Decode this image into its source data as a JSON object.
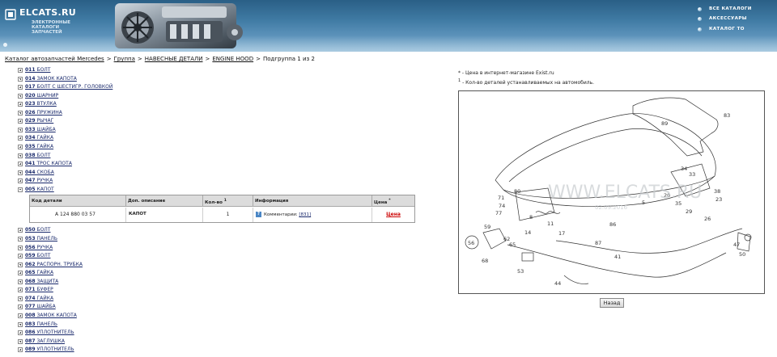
{
  "header": {
    "logo_title": "ELCATS.RU",
    "logo_subtitle": "ЭЛЕКТРОННЫЕ КАТАЛОГИ\nЗАПЧАСТЕЙ",
    "nav": [
      "ВСЕ КАТАЛОГИ",
      "АКСЕССУАРЫ",
      "КАТАЛОГ ТО"
    ]
  },
  "breadcrumb": {
    "items": [
      "Каталог автозапчастей Mercedes",
      "Группа",
      "НАВЕСНЫЕ ДЕТАЛИ",
      "ENGINE HOOD"
    ],
    "separator": ">",
    "current": "Подгруппа 1 из 2"
  },
  "groups": [
    {
      "code": "011",
      "name": "БОЛТ",
      "expanded": false
    },
    {
      "code": "014",
      "name": "ЗАМОК КАПОТА",
      "expanded": false
    },
    {
      "code": "017",
      "name": "БОЛТ С ШЕСТИГР. ГОЛОВКОЙ",
      "expanded": false
    },
    {
      "code": "020",
      "name": "ШАРНИР",
      "expanded": false
    },
    {
      "code": "023",
      "name": "ВТУЛКА",
      "expanded": false
    },
    {
      "code": "026",
      "name": "ПРУЖИНА",
      "expanded": false
    },
    {
      "code": "029",
      "name": "РЫЧАГ",
      "expanded": false
    },
    {
      "code": "033",
      "name": "ШАЙБА",
      "expanded": false
    },
    {
      "code": "034",
      "name": "ГАЙКА",
      "expanded": false
    },
    {
      "code": "035",
      "name": "ГАЙКА",
      "expanded": false
    },
    {
      "code": "038",
      "name": "БОЛТ",
      "expanded": false
    },
    {
      "code": "041",
      "name": "ТРОС КАПОТА",
      "expanded": false
    },
    {
      "code": "044",
      "name": "СКОБА",
      "expanded": false
    },
    {
      "code": "047",
      "name": "РУЧКА",
      "expanded": false
    },
    {
      "code": "005",
      "name": "КАПОТ",
      "expanded": true
    },
    {
      "code": "050",
      "name": "БОЛТ",
      "expanded": false
    },
    {
      "code": "053",
      "name": "ПАНЕЛЬ",
      "expanded": false
    },
    {
      "code": "056",
      "name": "РУЧКА",
      "expanded": false
    },
    {
      "code": "059",
      "name": "БОЛТ",
      "expanded": false
    },
    {
      "code": "062",
      "name": "РАСПОРН. ТРУБКА",
      "expanded": false
    },
    {
      "code": "065",
      "name": "ГАЙКА",
      "expanded": false
    },
    {
      "code": "068",
      "name": "ЗАЩИТА",
      "expanded": false
    },
    {
      "code": "071",
      "name": "БУФЕР",
      "expanded": false
    },
    {
      "code": "074",
      "name": "ГАЙКА",
      "expanded": false
    },
    {
      "code": "077",
      "name": "ШАЙБА",
      "expanded": false
    },
    {
      "code": "008",
      "name": "ЗАМОК КАПОТА",
      "expanded": false
    },
    {
      "code": "083",
      "name": "ПАНЕЛЬ",
      "expanded": false
    },
    {
      "code": "086",
      "name": "УПЛОТНИТЕЛЬ",
      "expanded": false
    },
    {
      "code": "087",
      "name": "ЗАГЛУШКА",
      "expanded": false
    },
    {
      "code": "089",
      "name": "УПЛОТНИТЕЛЬ",
      "expanded": false
    }
  ],
  "parts_table": {
    "headers": {
      "code": "Код детали",
      "desc": "Доп. описание",
      "qty": "Кол-во",
      "qty_sup": "1",
      "info": "Информация",
      "price": "Цена",
      "price_sup": "*"
    },
    "row": {
      "code": "A  124 880 03 57",
      "desc": "КАПОТ",
      "qty": "1",
      "info_prefix": "Комментарии:",
      "info_link": "[831]",
      "price": "Цена"
    }
  },
  "notes": {
    "price_mark": "*",
    "price_text": " - Цена в интернет-магазине Exist.ru",
    "qty_mark": "1",
    "qty_text": " - Кол-во деталей устанавливаемых на автомобиль."
  },
  "diagram": {
    "watermark": "WWW.ELCATS.RU",
    "watermark_date": "02.09.2016",
    "callouts": [
      "89",
      "83",
      "34",
      "33",
      "20",
      "38",
      "23",
      "35",
      "29",
      "26",
      "71",
      "80",
      "74",
      "77",
      "8",
      "5",
      "11",
      "86",
      "59",
      "17",
      "56",
      "62",
      "65",
      "14",
      "87",
      "41",
      "47",
      "68",
      "50",
      "53",
      "44"
    ]
  },
  "back_button": "Назад",
  "colors": {
    "header": "#3f7aa3",
    "link": "#1a2a6c",
    "price": "#cc0000"
  }
}
